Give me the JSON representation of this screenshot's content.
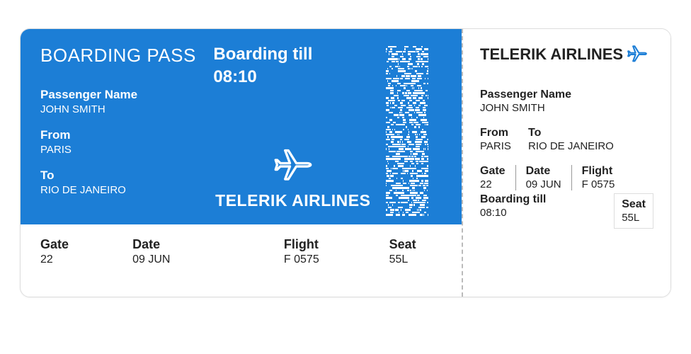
{
  "main": {
    "title": "BOARDING PASS",
    "boarding_till_label": "Boarding till",
    "boarding_till_time": "08:10",
    "passenger_label": "Passenger Name",
    "passenger_value": "JOHN SMITH",
    "from_label": "From",
    "from_value": "PARIS",
    "to_label": "To",
    "to_value": "RIO DE JANEIRO",
    "airline": "TELERIK AIRLINES",
    "bottom": {
      "gate_label": "Gate",
      "gate_value": "22",
      "date_label": "Date",
      "date_value": "09 JUN",
      "flight_label": "Flight",
      "flight_value": "F 0575",
      "seat_label": "Seat",
      "seat_value": "55L"
    }
  },
  "stub": {
    "airline": "TELERIK AIRLINES",
    "passenger_label": "Passenger Name",
    "passenger_value": "JOHN SMITH",
    "from_label": "From",
    "from_value": "PARIS",
    "to_label": "To",
    "to_value": "RIO DE JANEIRO",
    "gate_label": "Gate",
    "gate_value": "22",
    "date_label": "Date",
    "date_value": "09 JUN",
    "flight_label": "Flight",
    "flight_value": "F 0575",
    "boarding_till_label": "Boarding till",
    "boarding_till_time": "08:10",
    "seat_label": "Seat",
    "seat_value": "55L"
  },
  "colors": {
    "brand_blue": "#1c7ed6"
  }
}
